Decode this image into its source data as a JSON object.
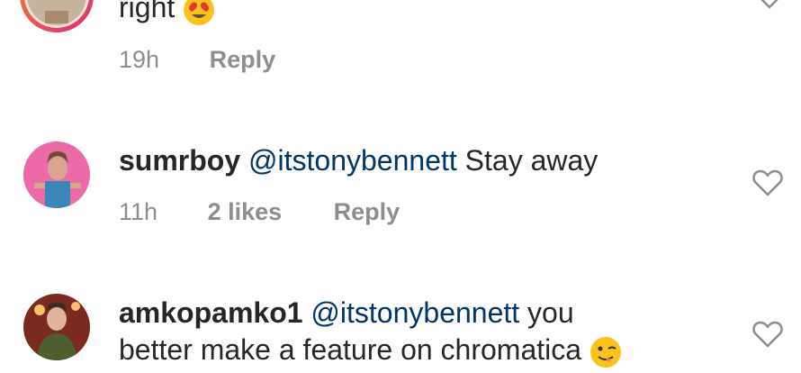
{
  "comments": [
    {
      "text_before_emoji": "right",
      "emoji": "smiling-face-with-heart-eyes",
      "time": "19h",
      "reply_label": "Reply"
    },
    {
      "username": "sumrboy",
      "mention": "@itstonybennett",
      "text": "Stay away",
      "time": "11h",
      "likes": "2 likes",
      "reply_label": "Reply"
    },
    {
      "username": "amkopamko1",
      "mention": "@itstonybennett",
      "text_line1": "you",
      "text_line2": "better make a feature on chromatica",
      "emoji": "winking-face-with-tongue",
      "time": "",
      "reply_label": ""
    }
  ],
  "colors": {
    "text": "#262626",
    "mention": "#003569",
    "meta": "#8e8e8e",
    "heart_outline": "#8e8e8e"
  }
}
